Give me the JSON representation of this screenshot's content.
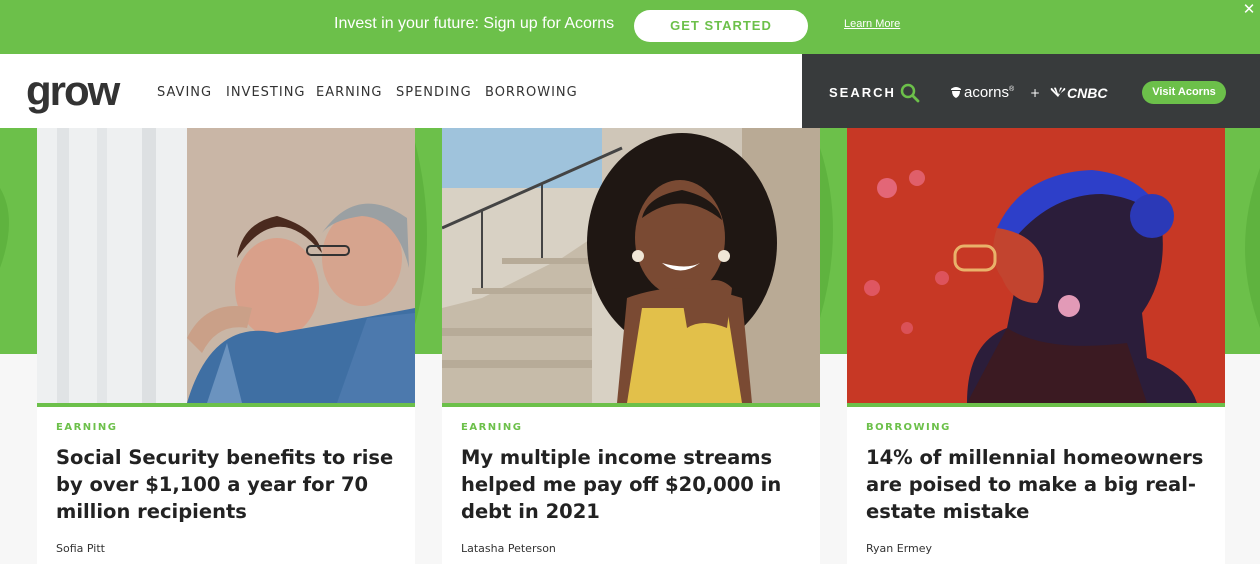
{
  "promo": {
    "text": "Invest in your future: Sign up for Acorns",
    "cta_label": "GET STARTED",
    "learn_more": "Learn More",
    "close_symbol": "✕"
  },
  "header": {
    "logo": "grow",
    "nav": [
      "SAVING",
      "INVESTING",
      "EARNING",
      "SPENDING",
      "BORROWING"
    ],
    "search_label": "SEARCH",
    "search_icon": "search-icon",
    "partner_acorns": "acorns",
    "plus": "+",
    "partner_cnbc": "CNBC",
    "visit_button": "Visit Acorns"
  },
  "colors": {
    "brand_green": "#6cc04a",
    "dark_header": "#383b3c",
    "text_dark": "#222222"
  },
  "cards": [
    {
      "category": "EARNING",
      "headline": "Social Security benefits to rise by over $1,100 a year for 70 million recipients",
      "author": "Sofia Pitt",
      "image": "elderly-couple-photo"
    },
    {
      "category": "EARNING",
      "headline": "My multiple income streams helped me pay off $20,000 in debt in 2021",
      "author": "Latasha Peterson",
      "image": "smiling-woman-on-stairs-photo"
    },
    {
      "category": "BORROWING",
      "headline": "14% of millennial homeowners are poised to make a big real-estate mistake",
      "author": "Ryan Ermey",
      "image": "woman-in-red-light-photo"
    }
  ]
}
